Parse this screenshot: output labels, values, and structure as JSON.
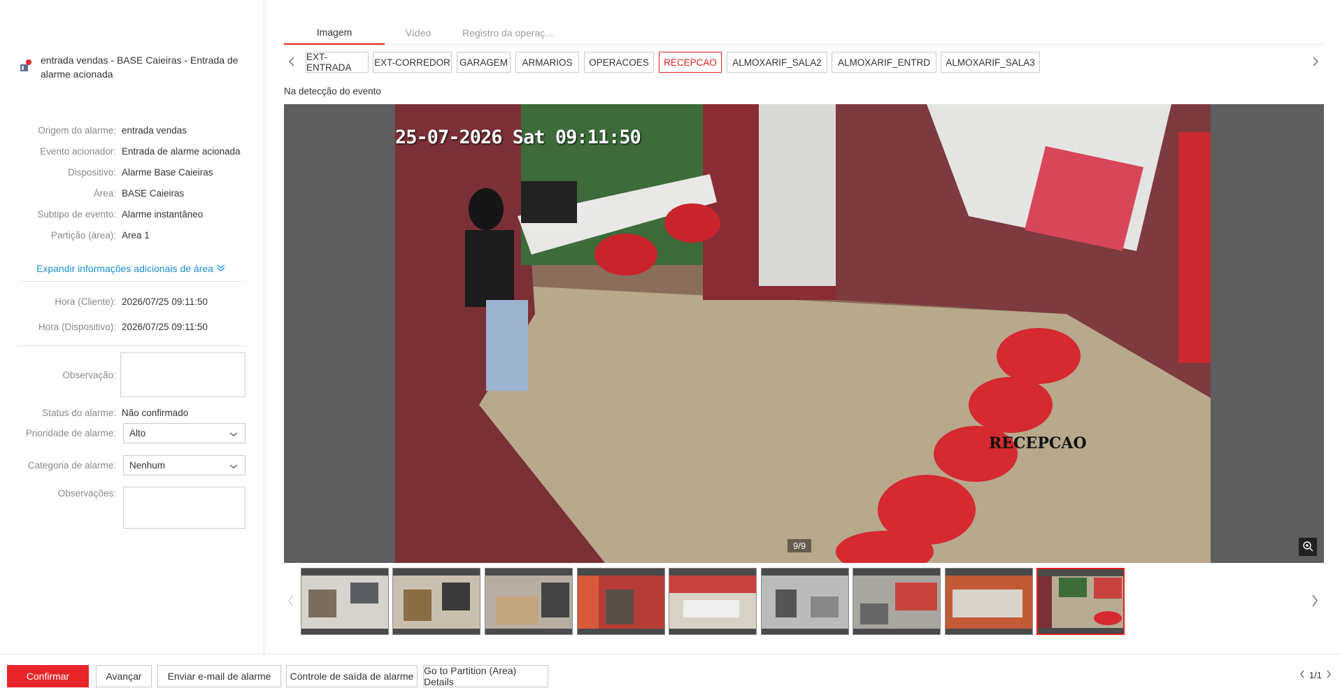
{
  "alarm": {
    "title": "entrada vendas - BASE Caieiras - Entrada de alarme acionada",
    "details": [
      {
        "label": "Origem do alarme:",
        "value": "entrada vendas"
      },
      {
        "label": "Evento acionador:",
        "value": "Entrada de alarme acionada"
      },
      {
        "label": "Dispositivo:",
        "value": "Alarme Base Caieiras"
      },
      {
        "label": "Área:",
        "value": "BASE Caieiras"
      },
      {
        "label": "Subtipo de evento:",
        "value": "Alarme instantâneo"
      },
      {
        "label": "Partição (área):",
        "value": "Area 1"
      }
    ],
    "expand_label": "Expandir informações adicionais de área",
    "time_client_label": "Hora (Cliente):",
    "time_client_value": "2026/07/25 09:11:50",
    "time_device_label": "Hora (Dispositivo):",
    "time_device_value": "2026/07/25 09:11:50",
    "observation_label": "Observação:",
    "status_label": "Status do alarme:",
    "status_value": "Não confirmado",
    "priority_label": "Prioridade de alarme:",
    "priority_value": "Alto",
    "category_label": "Categoria de alarme:",
    "category_value": "Nenhum",
    "remarks_label": "Observações:"
  },
  "tabs": [
    "Imagem",
    "Vídeo",
    "Registro da operaç..."
  ],
  "cameras": [
    "EXT-ENTRADA",
    "EXT-CORREDOR",
    "GARAGEM",
    "ARMARIOS",
    "OPERACOES",
    "RECEPCAO",
    "ALMOXARIF_SALA2",
    "ALMOXARIF_ENTRD",
    "ALMOXARIF_SALA3"
  ],
  "active_camera": "RECEPCAO",
  "caption": "Na detecção do evento",
  "viewer": {
    "timestamp": "25-07-2026 Sat 09:11:50",
    "camera_overlay": "RECEPCAO",
    "counter": "9/9"
  },
  "thumbnails_count": 9,
  "footer": {
    "confirm": "Confirmar",
    "advance": "Avançar",
    "email": "Enviar e-mail de alarme",
    "output_control": "Controle de saída de alarme",
    "partition_details": "Go to Partition (Area) Details",
    "pager": "1/1"
  },
  "colors": {
    "accent": "#e8262a",
    "link": "#1890d4"
  }
}
